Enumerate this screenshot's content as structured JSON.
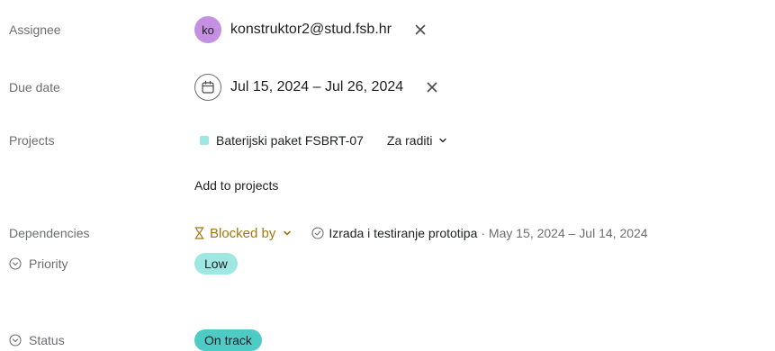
{
  "assignee": {
    "label": "Assignee",
    "avatar_initials": "ko",
    "name": "konstruktor2@stud.fsb.hr",
    "remove_icon": "close-icon"
  },
  "due_date": {
    "label": "Due date",
    "value": "Jul 15, 2024 – Jul 26, 2024",
    "icon": "calendar-icon",
    "remove_icon": "close-icon"
  },
  "projects": {
    "label": "Projects",
    "items": [
      {
        "name": "Baterijski paket FSBRT-07",
        "section": "Za raditi",
        "color": "#9ee7e3"
      }
    ],
    "add_label": "Add to projects"
  },
  "dependencies": {
    "label": "Dependencies",
    "blocked_label": "Blocked by",
    "blocked_color": "#a5760c",
    "task_name": "Izrada i testiranje prototipa",
    "task_dates": "· May 15, 2024 – Jul 14, 2024"
  },
  "priority": {
    "label": "Priority",
    "value": "Low",
    "color": "#9ee7e3"
  },
  "status": {
    "label": "Status",
    "value": "On track",
    "color": "#4ecbc4"
  }
}
